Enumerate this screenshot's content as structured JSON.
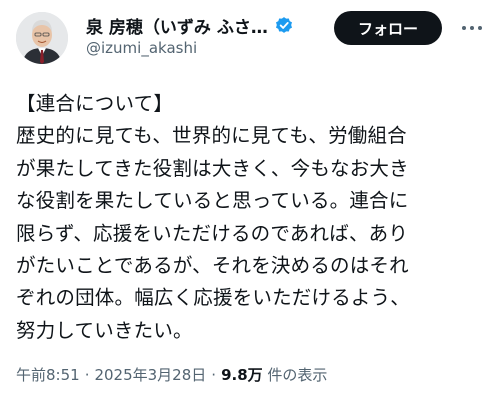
{
  "user": {
    "display_name": "泉 房穂（いずみ ふさ…",
    "handle": "@izumi_akashi",
    "verified_icon": "verified-badge-icon",
    "badge_color": "#1d9bf0"
  },
  "header": {
    "follow_label": "フォロー",
    "more_icon": "more-options-icon"
  },
  "tweet": {
    "lines": [
      "【連合について】",
      "歴史的に見ても、世界的に見ても、労働組合",
      "が果たしてきた役割は大きく、今もなお大き",
      "な役割を果たしていると思っている。連合に",
      "限らず、応援をいただけるのであれば、あり",
      "がたいことであるが、それを決めるのはそれ",
      "ぞれの団体。幅広く応援をいただけるよう、",
      "努力していきたい。"
    ]
  },
  "meta": {
    "time": "午前8:51",
    "separator": "·",
    "date": "2025年3月28日",
    "views_count": "9.8万",
    "views_label": "件の表示"
  }
}
